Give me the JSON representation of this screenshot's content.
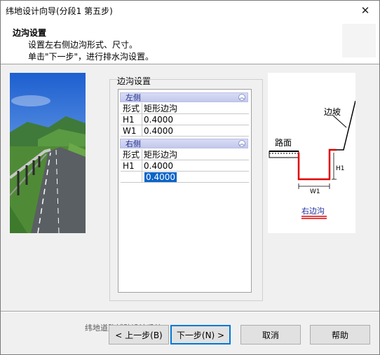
{
  "window": {
    "title": "纬地设计向导(分段1 第五步)"
  },
  "header": {
    "title": "边沟设置",
    "line1": "设置左右侧边沟形式、尺寸。",
    "line2": "单击\"下一步\"，进行排水沟设置。"
  },
  "group": {
    "label": "边沟设置"
  },
  "grid": {
    "left": {
      "header": "左侧",
      "rows": [
        {
          "name": "形式",
          "value": "矩形边沟"
        },
        {
          "name": "H1",
          "value": "0.4000"
        },
        {
          "name": "W1",
          "value": "0.4000"
        }
      ]
    },
    "right": {
      "header": "右侧",
      "rows": [
        {
          "name": "形式",
          "value": "矩形边沟"
        },
        {
          "name": "H1",
          "value": "0.4000"
        },
        {
          "name": "",
          "value": "0.4000"
        }
      ]
    }
  },
  "diagram": {
    "slope_label": "边坡",
    "road_label": "路面",
    "h1_label": "H1",
    "w1_label": "W1",
    "caption": "右边沟"
  },
  "footer": {
    "text": "纬地道路辅助设计系统"
  },
  "buttons": {
    "prev": "< 上一步(B)",
    "next": "下一步(N) >",
    "cancel": "取消",
    "help": "帮助"
  },
  "colors": {
    "accent": "#0078d7",
    "ditch": "#e00000",
    "selection": "#0a64c8",
    "section_header": "#c3c8ec"
  }
}
